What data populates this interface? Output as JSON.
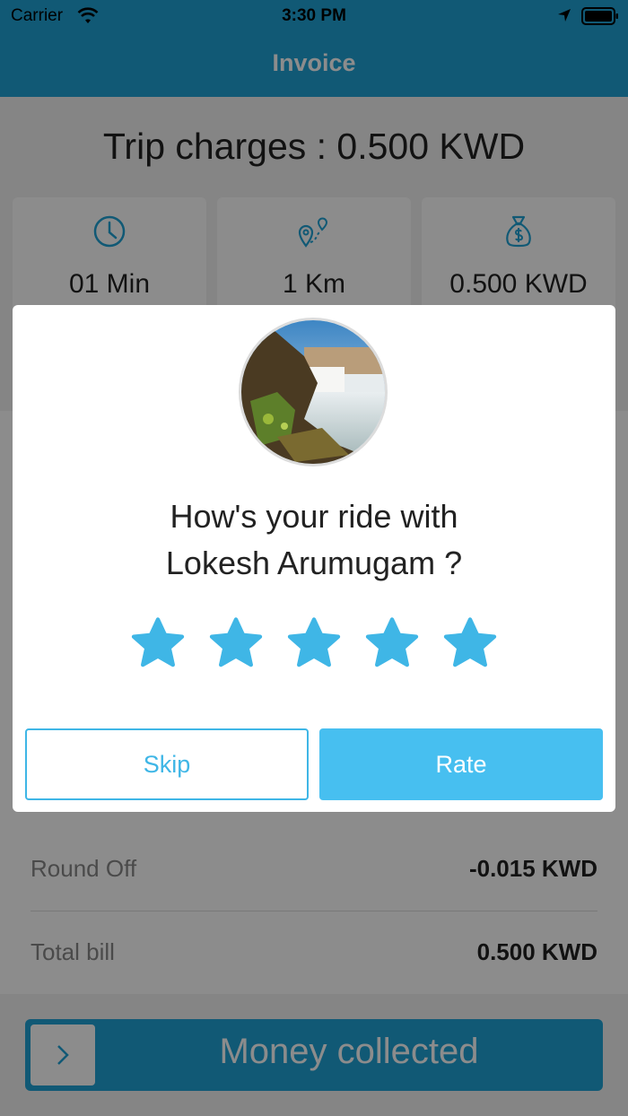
{
  "status_bar": {
    "carrier": "Carrier",
    "time": "3:30 PM"
  },
  "nav": {
    "title": "Invoice"
  },
  "trip": {
    "title": "Trip charges : 0.500 KWD"
  },
  "stats": [
    {
      "icon": "clock-icon",
      "value": "01 Min"
    },
    {
      "icon": "route-pin-icon",
      "value": "1 Km"
    },
    {
      "icon": "money-bag-icon",
      "value": "0.500 KWD"
    }
  ],
  "rows": [
    {
      "label": "Round Off",
      "value": "-0.015 KWD"
    },
    {
      "label": "Total bill",
      "value": "0.500 KWD"
    }
  ],
  "bottom_action": {
    "label": "Money collected"
  },
  "modal": {
    "prompt_line1": "How's your ride with",
    "prompt_line2": "Lokesh Arumugam ?",
    "rating": 5,
    "rating_max": 5,
    "skip_label": "Skip",
    "rate_label": "Rate"
  },
  "colors": {
    "accent": "#1fa3d6",
    "star": "#3fb6e6",
    "rate_button": "#47bff0"
  }
}
